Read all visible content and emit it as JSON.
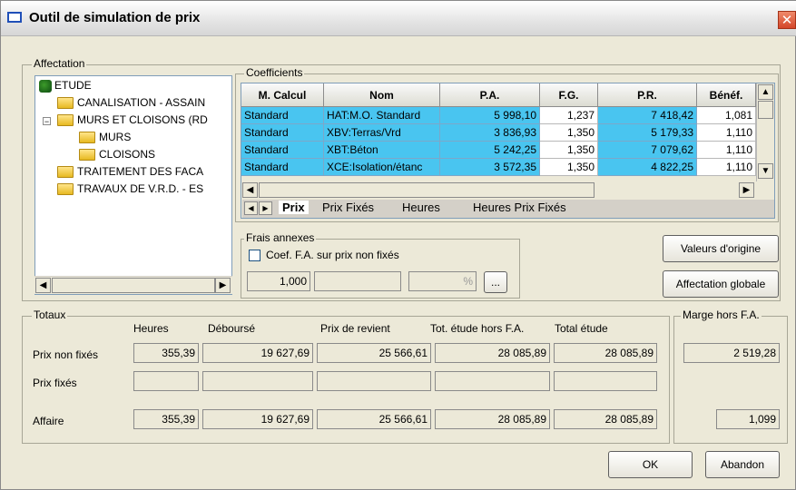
{
  "window": {
    "title": "Outil de simulation de prix",
    "close_glyph": "✕"
  },
  "affectation": {
    "legend": "Affectation",
    "tree": [
      {
        "label": "ETUDE",
        "icon": "root-node-icon"
      },
      {
        "label": "CANALISATION - ASSAIN",
        "icon": "folder-icon"
      },
      {
        "label": "MURS ET CLOISONS (RD",
        "icon": "folder-icon"
      },
      {
        "label": "MURS",
        "icon": "folder-icon"
      },
      {
        "label": "CLOISONS",
        "icon": "folder-icon"
      },
      {
        "label": "TRAITEMENT DES FACA",
        "icon": "folder-icon"
      },
      {
        "label": "TRAVAUX DE V.R.D. - ES",
        "icon": "folder-icon"
      }
    ],
    "expander_glyph": "−"
  },
  "coefficients": {
    "legend": "Coefficients",
    "columns": [
      "M. Calcul",
      "Nom",
      "P.A.",
      "F.G.",
      "P.R.",
      "Bénéf."
    ],
    "rows": [
      [
        "Standard",
        "HAT:M.O. Standard",
        "5 998,10",
        "1,237",
        "7 418,42",
        "1,081"
      ],
      [
        "Standard",
        "XBV:Terras/Vrd",
        "3 836,93",
        "1,350",
        "5 179,33",
        "1,110"
      ],
      [
        "Standard",
        "XBT:Béton",
        "5 242,25",
        "1,350",
        "7 079,62",
        "1,110"
      ],
      [
        "Standard",
        "XCE:Isolation/étanc",
        "3 572,35",
        "1,350",
        "4 822,25",
        "1,110"
      ]
    ],
    "tabs": [
      "Prix",
      "Prix Fixés",
      "Heures",
      "Heures Prix Fixés"
    ],
    "active_tab": "Prix"
  },
  "frais": {
    "legend": "Frais annexes",
    "checkbox_label": "Coef. F.A. sur prix non fixés",
    "coef_value": "1,000",
    "percent_symbol": "%",
    "browse_label": "..."
  },
  "buttons": {
    "valeurs_origine": "Valeurs d'origine",
    "affectation_globale": "Affectation globale",
    "ok": "OK",
    "abandon": "Abandon"
  },
  "totaux": {
    "legend": "Totaux",
    "columns": [
      "Heures",
      "Déboursé",
      "Prix de revient",
      "Tot. étude hors F.A.",
      "Total étude"
    ],
    "rows": [
      {
        "label": "Prix non fixés",
        "values": [
          "355,39",
          "19 627,69",
          "25 566,61",
          "28 085,89",
          "28 085,89"
        ]
      },
      {
        "label": "Prix fixés",
        "values": [
          "",
          "",
          "",
          "",
          ""
        ]
      },
      {
        "label": "Affaire",
        "values": [
          "355,39",
          "19 627,69",
          "25 566,61",
          "28 085,89",
          "28 085,89"
        ]
      }
    ]
  },
  "marge": {
    "legend": "Marge hors F.A.",
    "value": "2 519,28",
    "coef": "1,099"
  },
  "colors": {
    "selected_cell": "#49c5f0",
    "window_bg": "#ece9d8",
    "close_button": "#d4462a"
  }
}
